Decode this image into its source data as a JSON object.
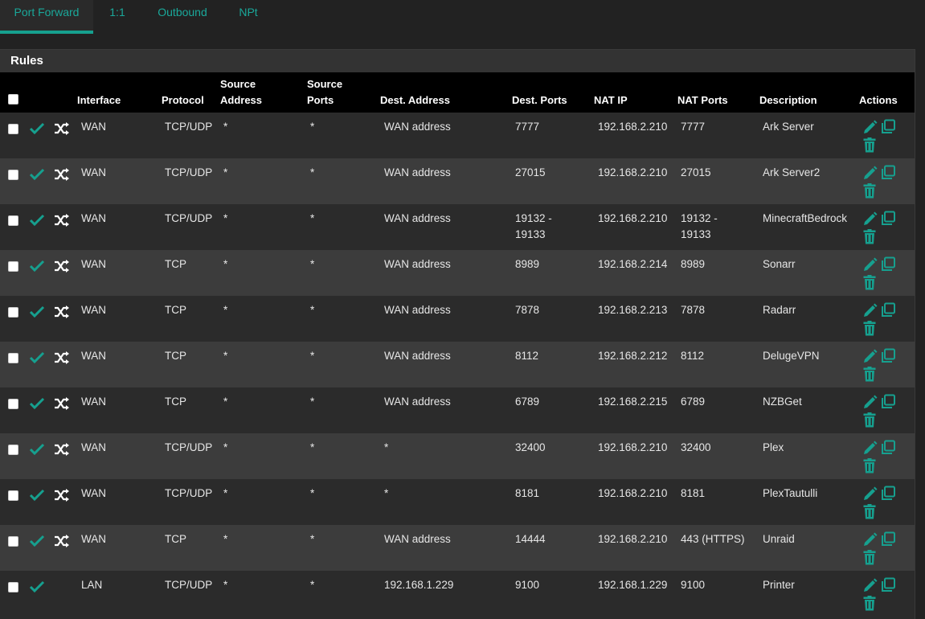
{
  "tabs": [
    {
      "label": "Port Forward",
      "active": true
    },
    {
      "label": "1:1",
      "active": false
    },
    {
      "label": "Outbound",
      "active": false
    },
    {
      "label": "NPt",
      "active": false
    }
  ],
  "panel": {
    "title": "Rules"
  },
  "columns": {
    "interface": "Interface",
    "protocol": "Protocol",
    "source_address": [
      "Source",
      "Address"
    ],
    "source_ports": [
      "Source",
      "Ports"
    ],
    "dest_address": "Dest. Address",
    "dest_ports": "Dest. Ports",
    "nat_ip": "NAT IP",
    "nat_ports": "NAT Ports",
    "description": "Description",
    "actions": "Actions"
  },
  "rows": [
    {
      "shuffle": true,
      "interface": "WAN",
      "protocol": "TCP/UDP",
      "source_address": "*",
      "source_ports": "*",
      "dest_address": "WAN address",
      "dest_ports": [
        "7777"
      ],
      "nat_ip": "192.168.2.210",
      "nat_ports": [
        "7777"
      ],
      "description": "Ark Server"
    },
    {
      "shuffle": true,
      "interface": "WAN",
      "protocol": "TCP/UDP",
      "source_address": "*",
      "source_ports": "*",
      "dest_address": "WAN address",
      "dest_ports": [
        "27015"
      ],
      "nat_ip": "192.168.2.210",
      "nat_ports": [
        "27015"
      ],
      "description": "Ark Server2"
    },
    {
      "shuffle": true,
      "interface": "WAN",
      "protocol": "TCP/UDP",
      "source_address": "*",
      "source_ports": "*",
      "dest_address": "WAN address",
      "dest_ports": [
        "19132 -",
        "19133"
      ],
      "nat_ip": "192.168.2.210",
      "nat_ports": [
        "19132 -",
        "19133"
      ],
      "description": "MinecraftBedrock"
    },
    {
      "shuffle": true,
      "interface": "WAN",
      "protocol": "TCP",
      "source_address": "*",
      "source_ports": "*",
      "dest_address": "WAN address",
      "dest_ports": [
        "8989"
      ],
      "nat_ip": "192.168.2.214",
      "nat_ports": [
        "8989"
      ],
      "description": "Sonarr"
    },
    {
      "shuffle": true,
      "interface": "WAN",
      "protocol": "TCP",
      "source_address": "*",
      "source_ports": "*",
      "dest_address": "WAN address",
      "dest_ports": [
        "7878"
      ],
      "nat_ip": "192.168.2.213",
      "nat_ports": [
        "7878"
      ],
      "description": "Radarr"
    },
    {
      "shuffle": true,
      "interface": "WAN",
      "protocol": "TCP",
      "source_address": "*",
      "source_ports": "*",
      "dest_address": "WAN address",
      "dest_ports": [
        "8112"
      ],
      "nat_ip": "192.168.2.212",
      "nat_ports": [
        "8112"
      ],
      "description": "DelugeVPN"
    },
    {
      "shuffle": true,
      "interface": "WAN",
      "protocol": "TCP",
      "source_address": "*",
      "source_ports": "*",
      "dest_address": "WAN address",
      "dest_ports": [
        "6789"
      ],
      "nat_ip": "192.168.2.215",
      "nat_ports": [
        "6789"
      ],
      "description": "NZBGet"
    },
    {
      "shuffle": true,
      "interface": "WAN",
      "protocol": "TCP/UDP",
      "source_address": "*",
      "source_ports": "*",
      "dest_address": "*",
      "dest_ports": [
        "32400"
      ],
      "nat_ip": "192.168.2.210",
      "nat_ports": [
        "32400"
      ],
      "description": "Plex"
    },
    {
      "shuffle": true,
      "interface": "WAN",
      "protocol": "TCP/UDP",
      "source_address": "*",
      "source_ports": "*",
      "dest_address": "*",
      "dest_ports": [
        "8181"
      ],
      "nat_ip": "192.168.2.210",
      "nat_ports": [
        "8181"
      ],
      "description": "PlexTautulli"
    },
    {
      "shuffle": true,
      "interface": "WAN",
      "protocol": "TCP",
      "source_address": "*",
      "source_ports": "*",
      "dest_address": "WAN address",
      "dest_ports": [
        "14444"
      ],
      "nat_ip": "192.168.2.210",
      "nat_ports": [
        "443 (HTTPS)"
      ],
      "description": "Unraid"
    },
    {
      "shuffle": false,
      "interface": "LAN",
      "protocol": "TCP/UDP",
      "source_address": "*",
      "source_ports": "*",
      "dest_address": "192.168.1.229",
      "dest_ports": [
        "9100"
      ],
      "nat_ip": "192.168.1.229",
      "nat_ports": [
        "9100"
      ],
      "description": "Printer"
    }
  ],
  "colors": {
    "accent": "#16a08f",
    "header_bg": "#000000",
    "row_even": "#2b2b2b",
    "row_odd": "#3c3c3c"
  },
  "icons": {
    "enabled": "check-icon",
    "shuffle": "shuffle-icon",
    "edit": "pencil-icon",
    "copy": "copy-icon",
    "delete": "trash-icon"
  }
}
